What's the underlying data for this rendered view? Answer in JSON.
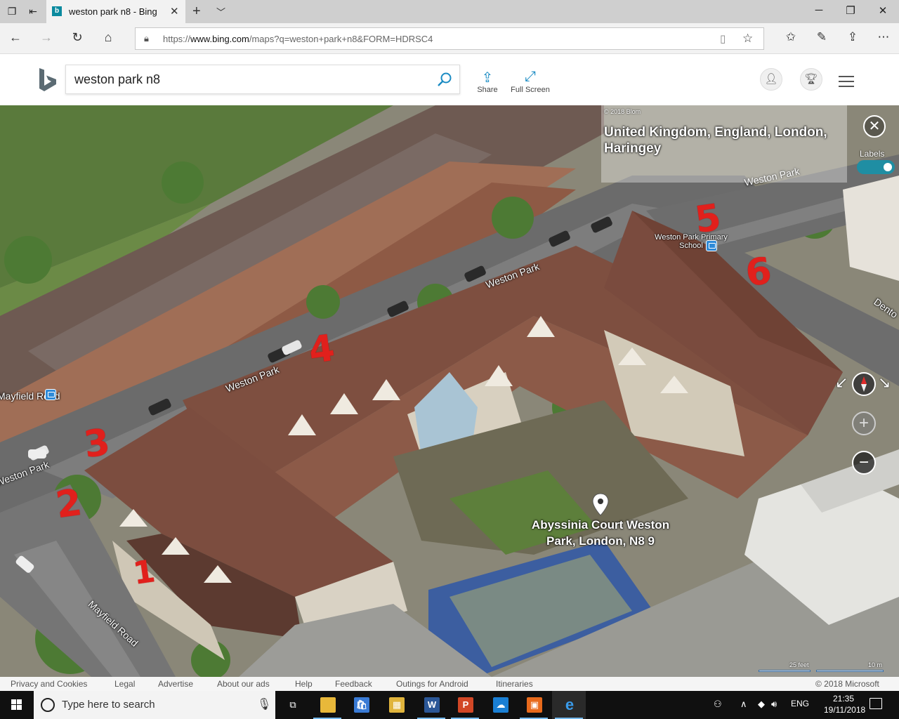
{
  "browser": {
    "tab_title": "weston park n8 - Bing M",
    "url_prefix": "https://",
    "url_domain": "www.bing.com",
    "url_rest": "/maps?q=weston+park+n8&FORM=HDRSC4"
  },
  "bing": {
    "search_query": "weston park n8",
    "share_label": "Share",
    "fullscreen_label": "Full Screen"
  },
  "map": {
    "copyright": "© 2018 Blom",
    "location": "United Kingdom, England, London, Haringey",
    "labels_toggle": "Labels",
    "labels_on": true,
    "road_labels": [
      "Weston Park",
      "Weston Park",
      "Weston Park",
      "Weston Park",
      "Mayfield Road",
      "Mayfield Road",
      "Dento"
    ],
    "school_label": "Weston Park Primary School",
    "pin_label": "Abyssinia Court Weston Park, London, N8 9",
    "annotation_numbers": [
      "1",
      "2",
      "3",
      "4",
      "5",
      "6"
    ],
    "scale_feet": "25 feet",
    "scale_meters": "10 m"
  },
  "footer": {
    "links": [
      "Privacy and Cookies",
      "Legal",
      "Advertise",
      "About our ads",
      "Help",
      "Feedback",
      "Outings for Android",
      "Itineraries"
    ],
    "copyright": "© 2018 Microsoft"
  },
  "taskbar": {
    "search_placeholder": "Type here to search",
    "language": "ENG",
    "time": "21:35",
    "date": "19/11/2018"
  },
  "colors": {
    "accent": "#1a8bc3",
    "toggle": "#1f8ea3",
    "annotation_red": "#e1201c"
  }
}
